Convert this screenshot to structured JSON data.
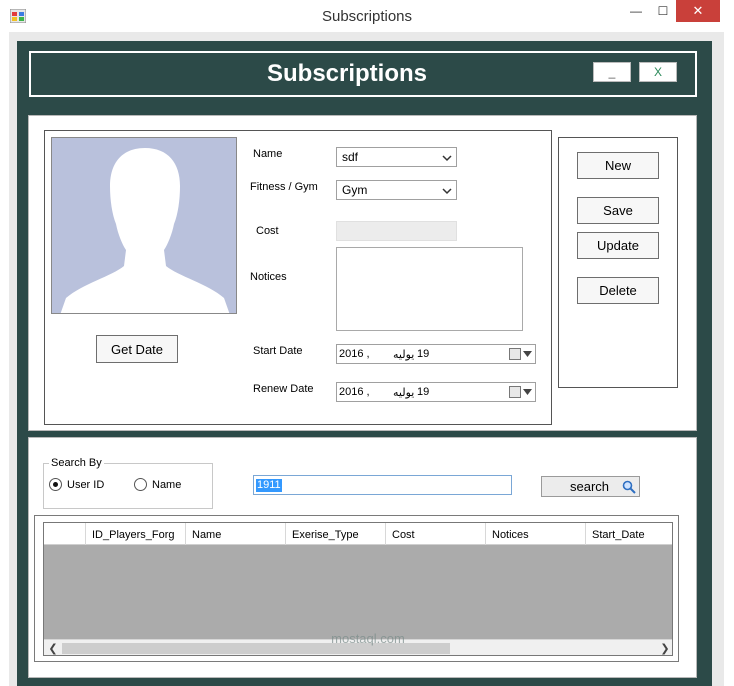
{
  "window": {
    "title": "Subscriptions",
    "min_glyph": "—",
    "max_glyph": "☐",
    "close_glyph": "✕"
  },
  "header": {
    "title": "Subscriptions",
    "min_label": "_",
    "close_label": "X"
  },
  "photo": {
    "icon": "person-silhouette-icon"
  },
  "buttons": {
    "get_date": "Get Date",
    "new": "New",
    "save": "Save",
    "update": "Update",
    "delete": "Delete",
    "search": "search"
  },
  "fields": {
    "name_label": "Name",
    "name_value": "sdf",
    "fitness_label": "Fitness / Gym",
    "fitness_value": "Gym",
    "cost_label": "Cost",
    "notices_label": "Notices",
    "start_label": "Start Date",
    "start_year": "2016 ,",
    "start_month": "يوليه",
    "start_day": "19",
    "renew_label": "Renew Date",
    "renew_year": "2016 ,",
    "renew_month": "يوليه",
    "renew_day": "19"
  },
  "search": {
    "group_label": "Search By",
    "option_userid": "User ID",
    "option_name": "Name",
    "selected": "User ID",
    "query": "1911"
  },
  "grid": {
    "columns": [
      "",
      "ID_Players_Forg",
      "Name",
      "Exerise_Type",
      "Cost",
      "Notices",
      "Start_Date"
    ]
  },
  "watermark": "mostaql.com",
  "colors": {
    "form_dark": "#2c4a48",
    "photo_bg": "#b9c1dc",
    "close_red": "#c9403a",
    "selection_blue": "#3399ff"
  }
}
